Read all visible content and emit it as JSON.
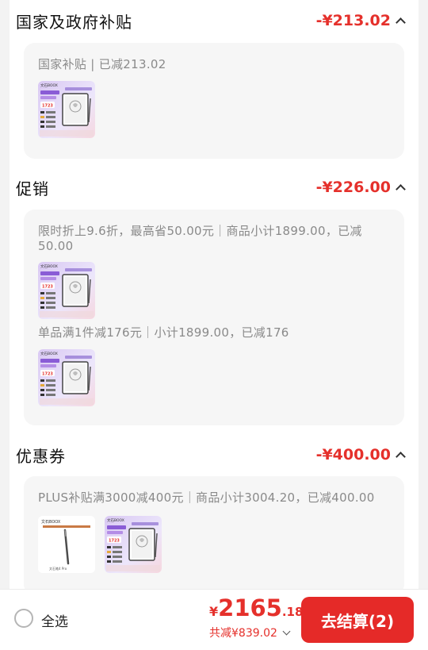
{
  "sections": [
    {
      "title": "国家及政府补贴",
      "amount": "-¥213.02",
      "lines": [
        "国家补贴 | 已减213.02"
      ]
    },
    {
      "title": "促销",
      "amount": "-¥226.00",
      "lines": [
        "限时折上9.6折，最高省50.00元｜商品小计1899.00，已减",
        "50.00",
        "单品满1件减176元｜小计1899.00，已减176"
      ]
    },
    {
      "title": "优惠券",
      "amount": "-¥400.00",
      "lines": [
        "PLUS补贴满3000减400元｜商品小计3004.20，已减400.00"
      ]
    }
  ],
  "product": {
    "brand": "文石BOOX",
    "price_tag": "1723"
  },
  "pen": {
    "brand": "文石BOOX",
    "caption": "文石笔4 Pro"
  },
  "footer": {
    "select_all": "全选",
    "currency": "¥",
    "total_int": "2165",
    "total_dec": ".18",
    "discount": "共减¥839.02",
    "checkout": "去结算(2)"
  },
  "colors": {
    "accent": "#e5302b",
    "checkout_bg": "#e52a28"
  }
}
